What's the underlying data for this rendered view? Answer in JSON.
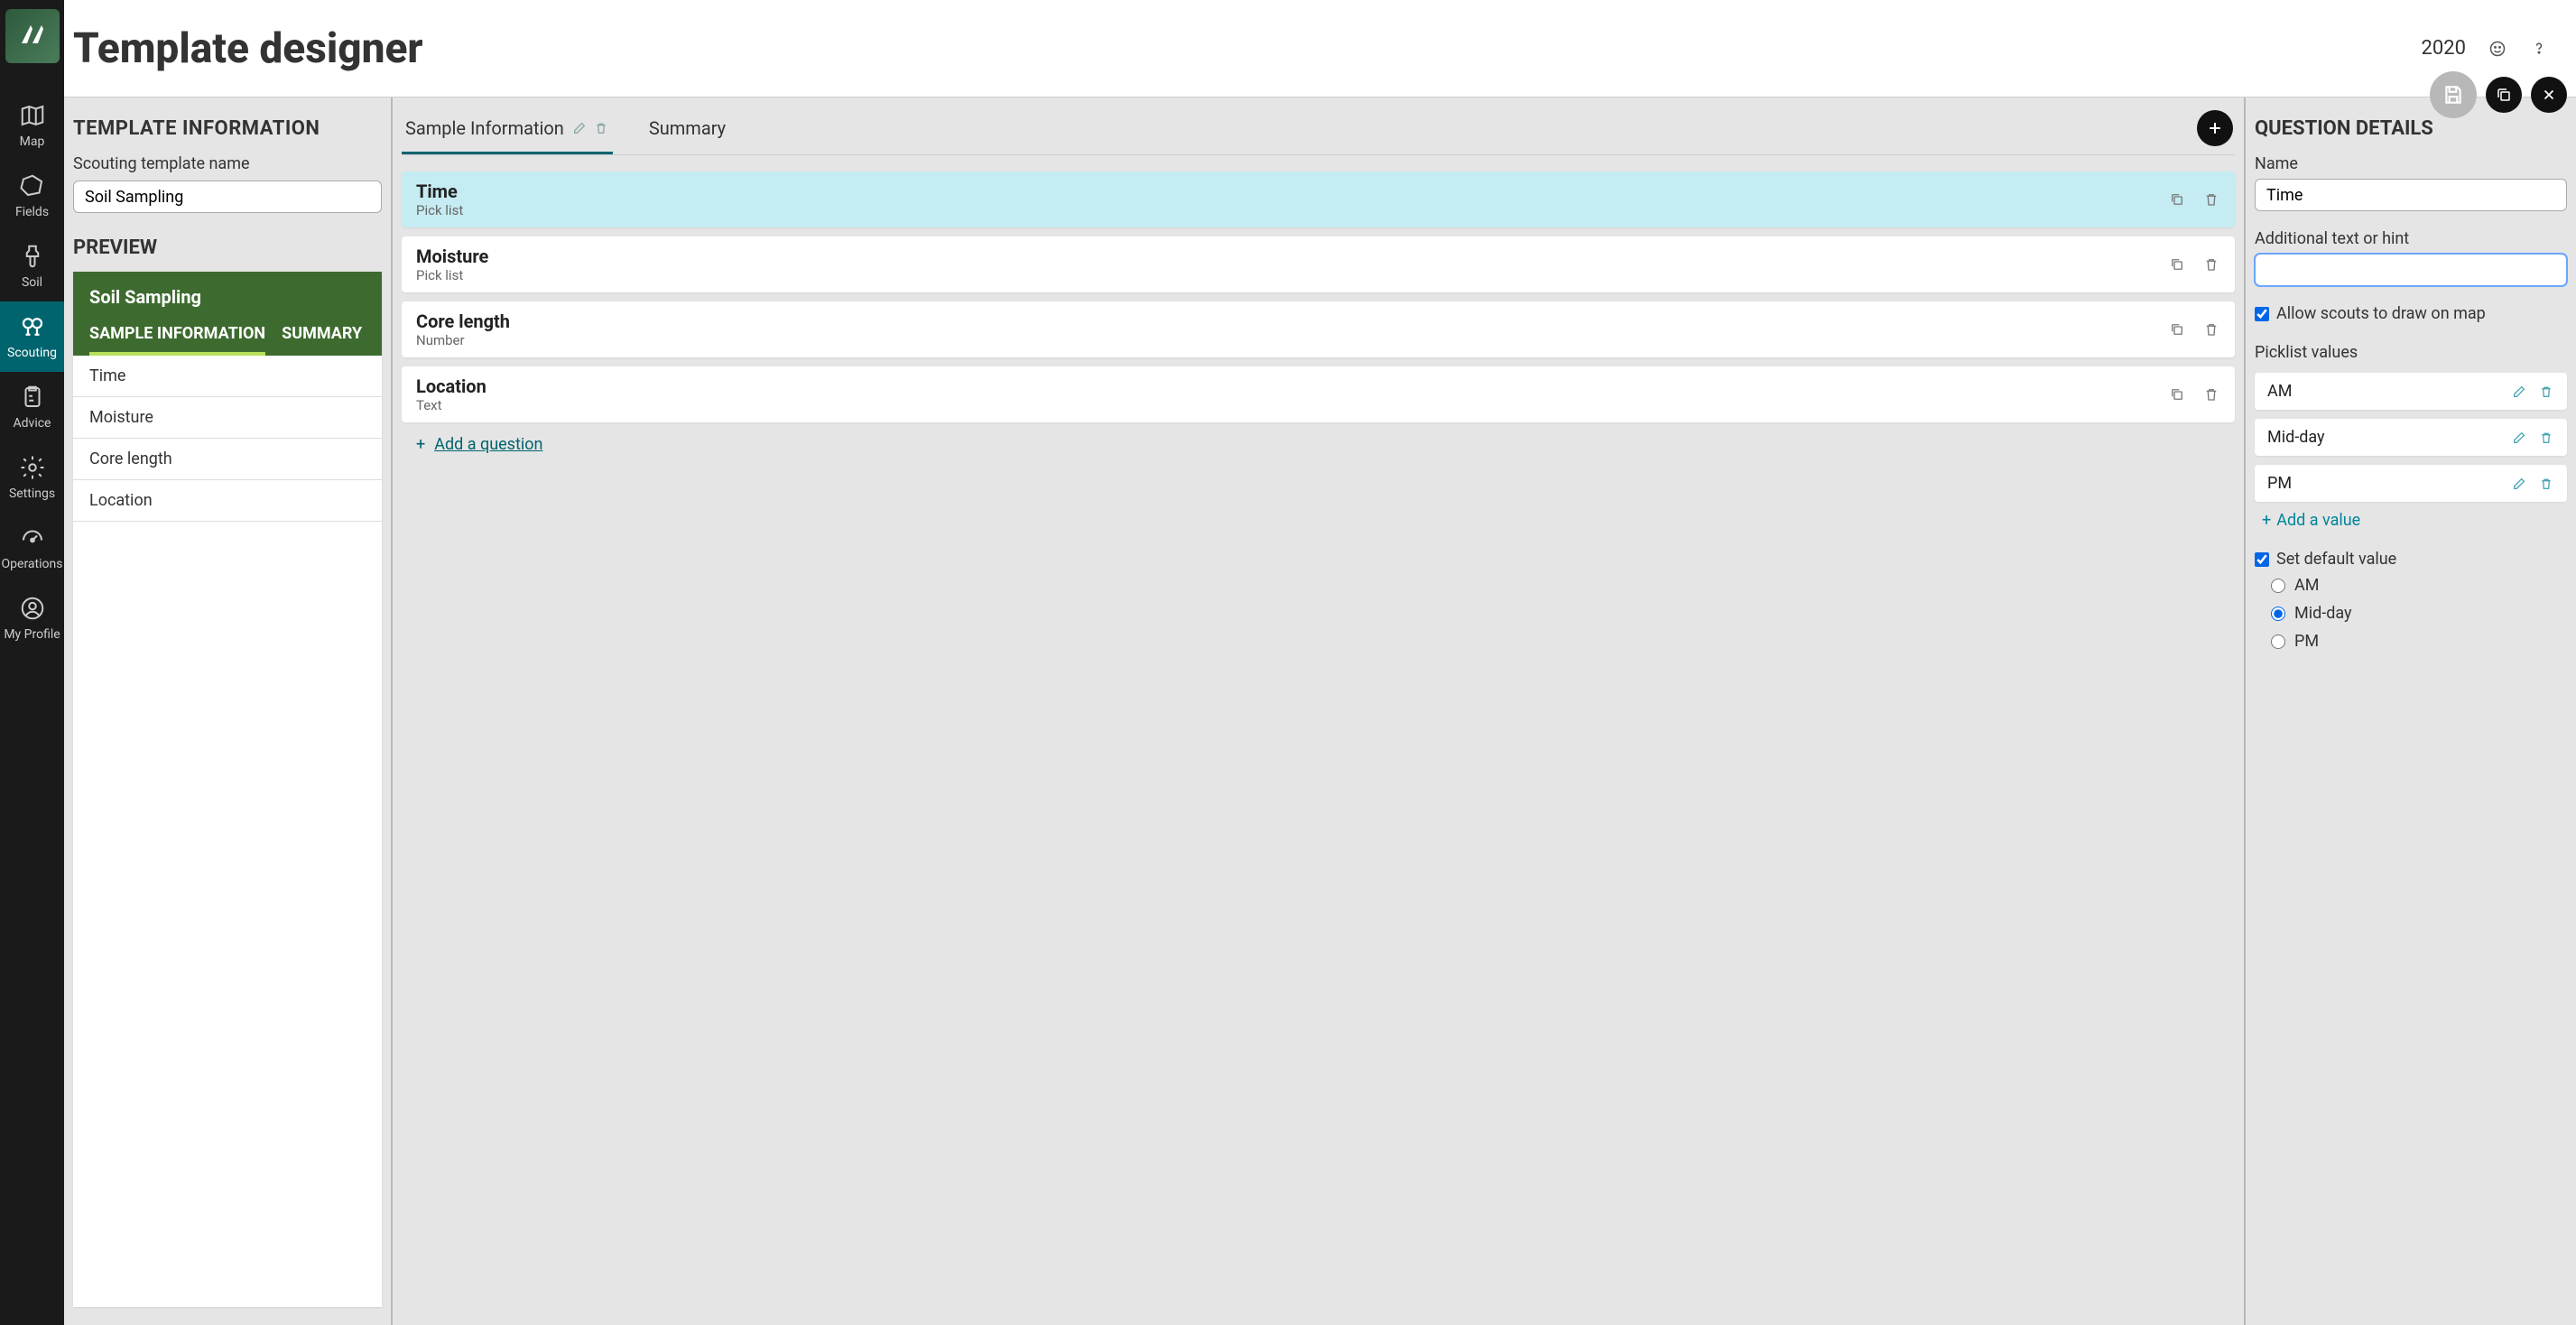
{
  "header": {
    "title": "Template designer",
    "year": "2020"
  },
  "sidebar": {
    "items": [
      {
        "id": "map",
        "label": "Map"
      },
      {
        "id": "fields",
        "label": "Fields"
      },
      {
        "id": "soil",
        "label": "Soil"
      },
      {
        "id": "scouting",
        "label": "Scouting",
        "active": true
      },
      {
        "id": "advice",
        "label": "Advice"
      },
      {
        "id": "settings",
        "label": "Settings"
      },
      {
        "id": "operations",
        "label": "Operations"
      },
      {
        "id": "myprofile",
        "label": "My Profile"
      }
    ]
  },
  "template_info": {
    "section_title": "TEMPLATE INFORMATION",
    "name_label": "Scouting template name",
    "name_value": "Soil Sampling",
    "preview_title": "PREVIEW",
    "preview_name": "Soil Sampling",
    "preview_tabs": [
      {
        "label": "SAMPLE INFORMATION",
        "active": true
      },
      {
        "label": "SUMMARY",
        "active": false
      }
    ],
    "preview_rows": [
      "Time",
      "Moisture",
      "Core length",
      "Location"
    ]
  },
  "sections": {
    "tabs": [
      {
        "label": "Sample Information",
        "active": true
      },
      {
        "label": "Summary",
        "active": false
      }
    ],
    "questions": [
      {
        "title": "Time",
        "type": "Pick list",
        "selected": true
      },
      {
        "title": "Moisture",
        "type": "Pick list",
        "selected": false
      },
      {
        "title": "Core length",
        "type": "Number",
        "selected": false
      },
      {
        "title": "Location",
        "type": "Text",
        "selected": false
      }
    ],
    "add_question_label": "Add a question"
  },
  "question_details": {
    "section_title": "QUESTION DETAILS",
    "name_label": "Name",
    "name_value": "Time",
    "hint_label": "Additional text or hint",
    "hint_value": "",
    "allow_draw_label": "Allow scouts to draw on map",
    "allow_draw_checked": true,
    "picklist_label": "Picklist values",
    "picklist": [
      "AM",
      "Mid-day",
      "PM"
    ],
    "add_value_label": "Add a value",
    "set_default_label": "Set default value",
    "set_default_checked": true,
    "default_options": [
      {
        "label": "AM",
        "checked": false
      },
      {
        "label": "Mid-day",
        "checked": true
      },
      {
        "label": "PM",
        "checked": false
      }
    ]
  }
}
